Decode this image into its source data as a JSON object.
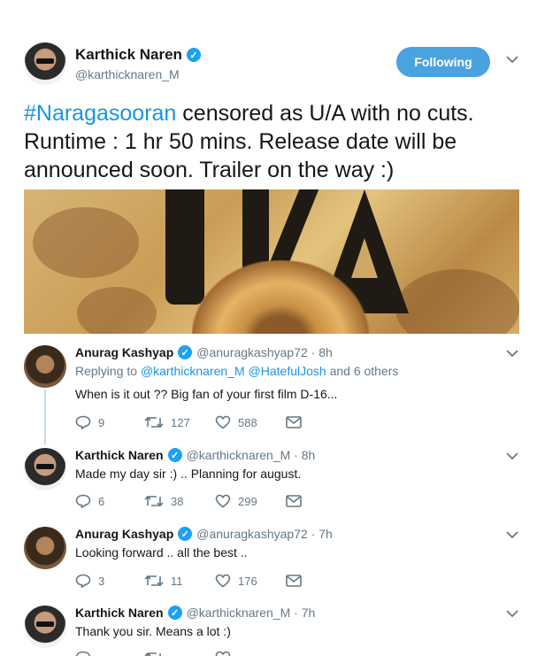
{
  "main_tweet": {
    "author_name": "Karthick Naren",
    "author_handle": "@karthicknaren_M",
    "follow_label": "Following",
    "hashtag": "#Naragasooran",
    "text": " censored as U/A with no cuts. Runtime : 1 hr 50 mins. Release date will be announced soon. Trailer on the way :)"
  },
  "replies": [
    {
      "name": "Anurag Kashyap",
      "handle": "@anuragkashyap72 · 8h",
      "replying_prefix": "Replying to ",
      "replying_link1": "@karthicknaren_M",
      "replying_link2": "@HatefulJosh",
      "replying_suffix": " and 6 others",
      "text": "When is it out ?? Big fan of your first film D-16...",
      "replies": "9",
      "retweets": "127",
      "likes": "588"
    },
    {
      "name": "Karthick Naren",
      "handle": "@karthicknaren_M · 8h",
      "text": "Made my day sir :) .. Planning for august.",
      "replies": "6",
      "retweets": "38",
      "likes": "299"
    },
    {
      "name": "Anurag Kashyap",
      "handle": "@anuragkashyap72 · 7h",
      "text": "Looking forward .. all the best ..",
      "replies": "3",
      "retweets": "11",
      "likes": "176"
    },
    {
      "name": "Karthick Naren",
      "handle": "@karthicknaren_M · 7h",
      "text": "Thank you sir. Means a lot :)"
    }
  ],
  "colors": {
    "accent": "#1da1f2",
    "follow_button": "#4aa3df",
    "muted": "#657786"
  }
}
